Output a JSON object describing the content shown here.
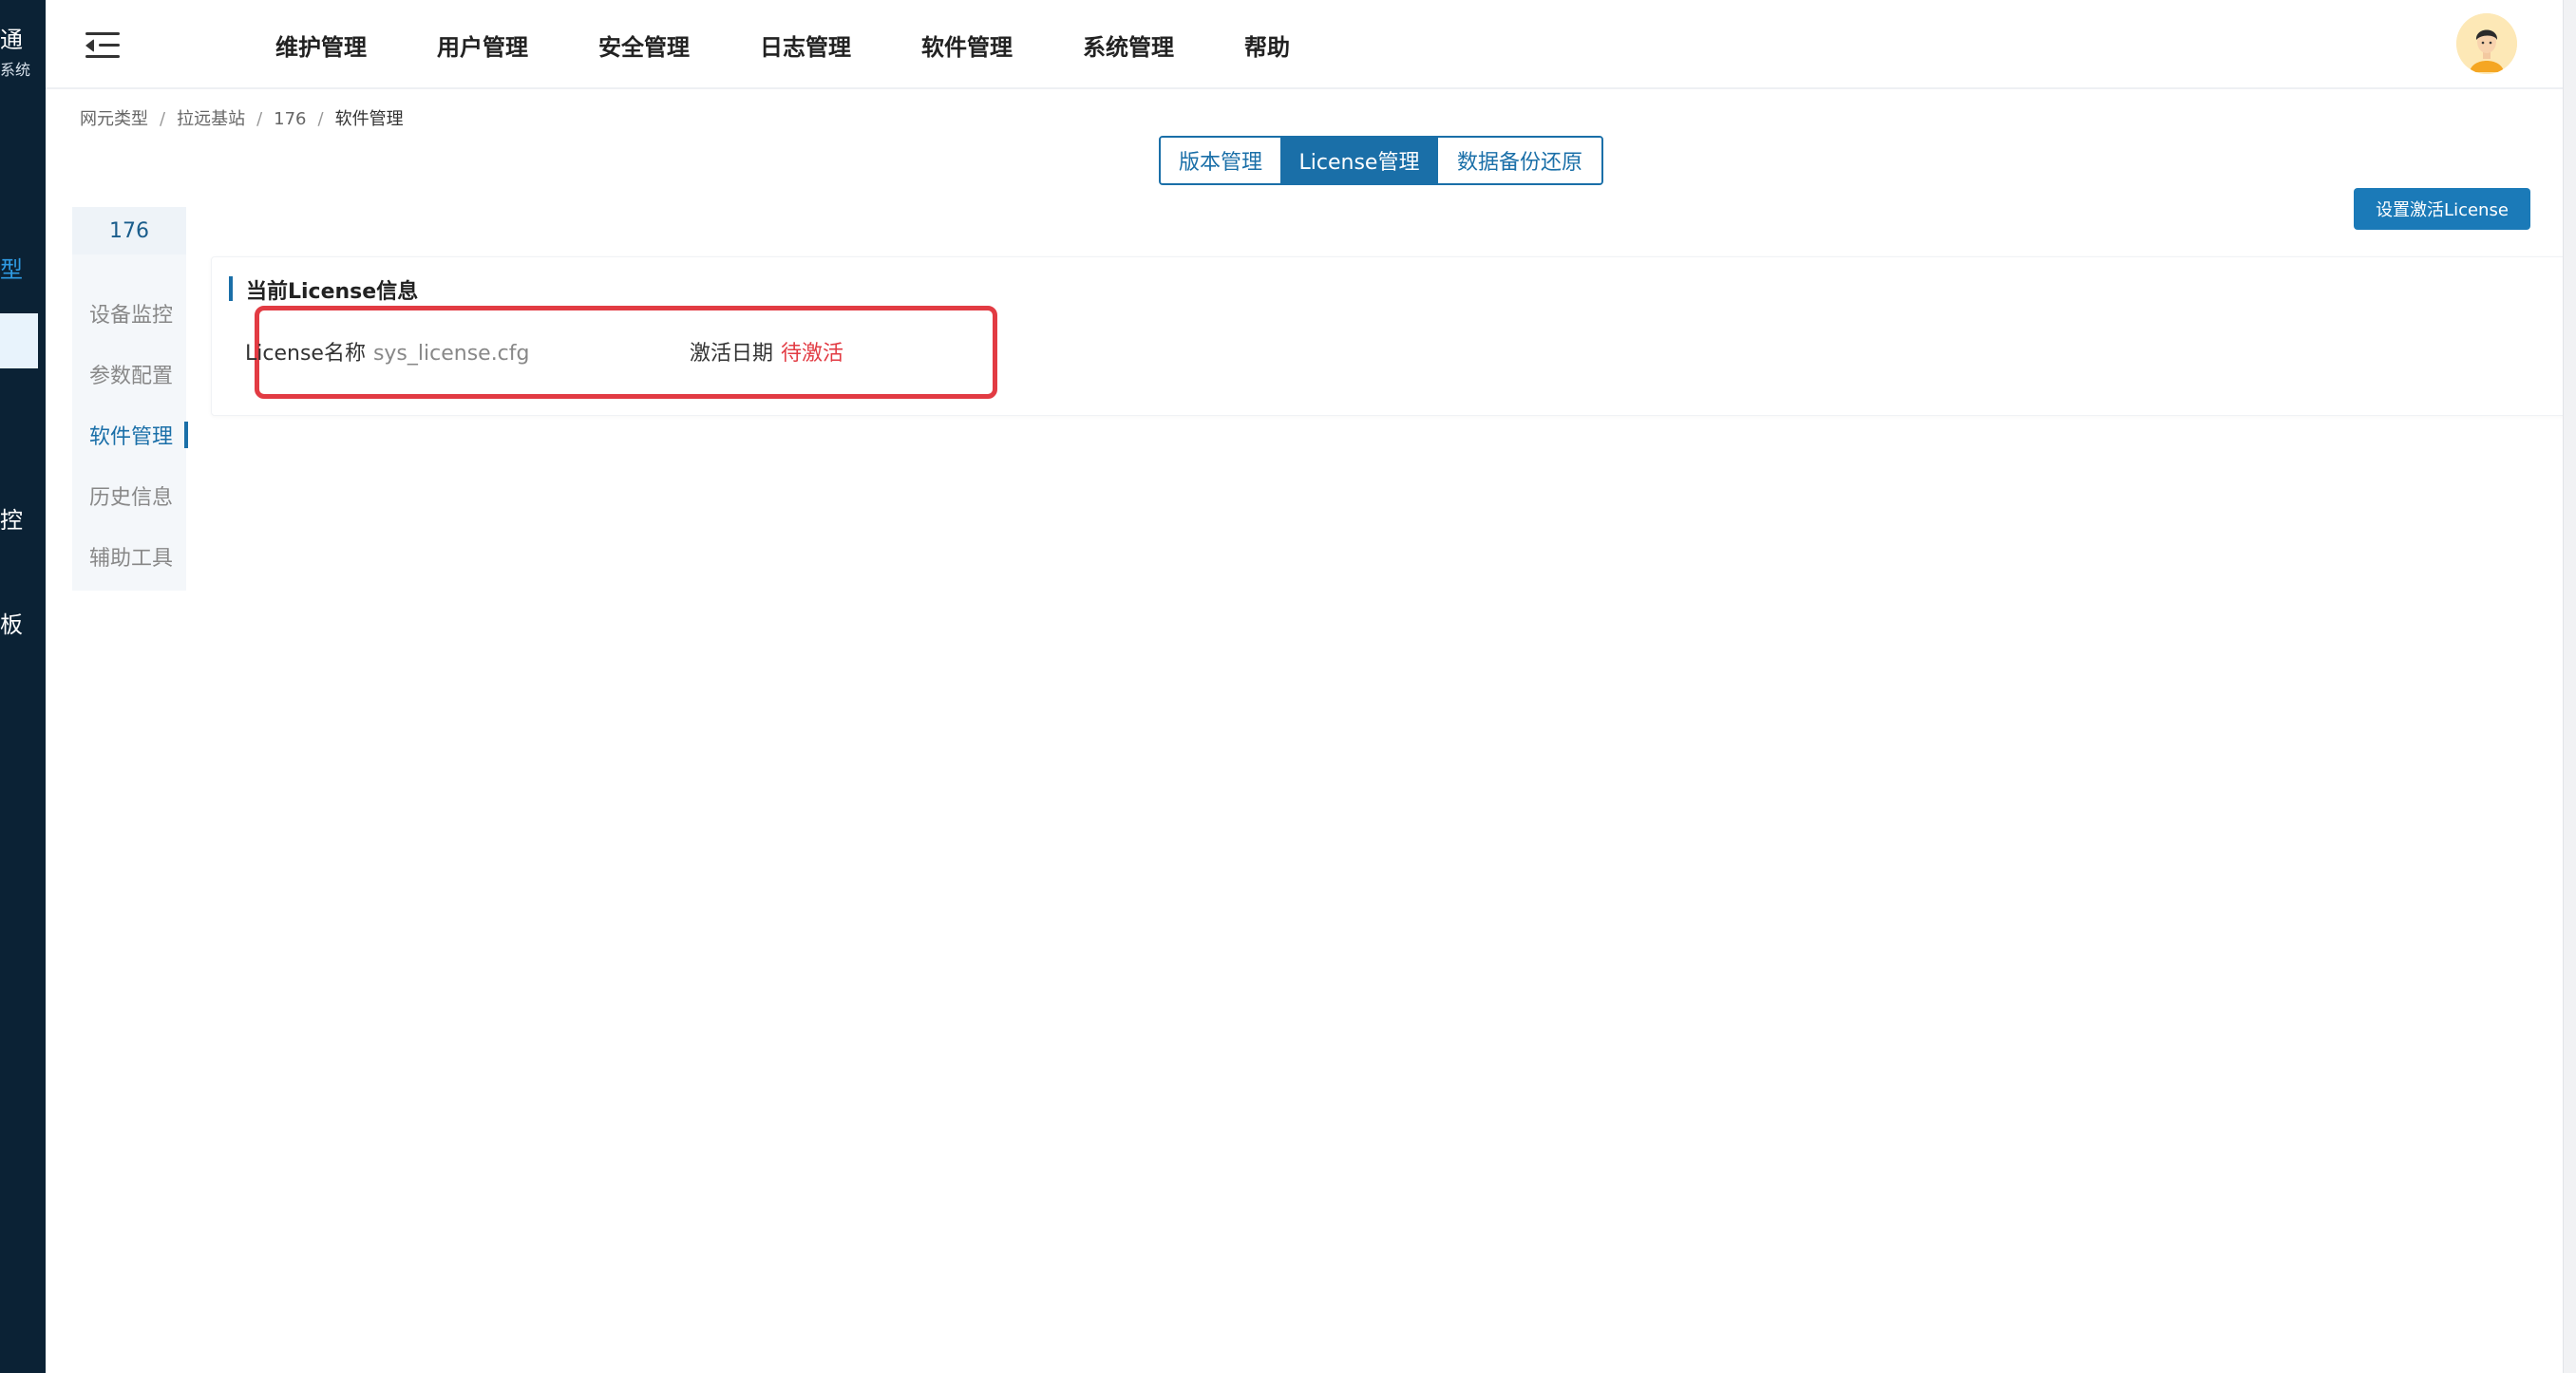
{
  "sidebar": {
    "fragments": [
      "通",
      "系统",
      "型",
      "控",
      "板"
    ]
  },
  "header": {
    "nav": [
      "维护管理",
      "用户管理",
      "安全管理",
      "日志管理",
      "软件管理",
      "系统管理",
      "帮助"
    ]
  },
  "breadcrumb": [
    "网元类型",
    "拉远基站",
    "176",
    "软件管理"
  ],
  "tabs": [
    "版本管理",
    "License管理",
    "数据备份还原"
  ],
  "active_tab": "License管理",
  "actions": {
    "activate_license": "设置激活License"
  },
  "subnav": {
    "title": "176",
    "items": [
      "设备监控",
      "参数配置",
      "软件管理",
      "历史信息",
      "辅助工具"
    ],
    "active": "软件管理"
  },
  "license": {
    "section_title": "当前License信息",
    "name_label": "License名称",
    "name_value": "sys_license.cfg",
    "date_label": "激活日期",
    "date_value": "待激活"
  },
  "colors": {
    "primary": "#1a6fa8",
    "sidebar_bg": "#0b2235",
    "highlight": "#e23b43"
  }
}
